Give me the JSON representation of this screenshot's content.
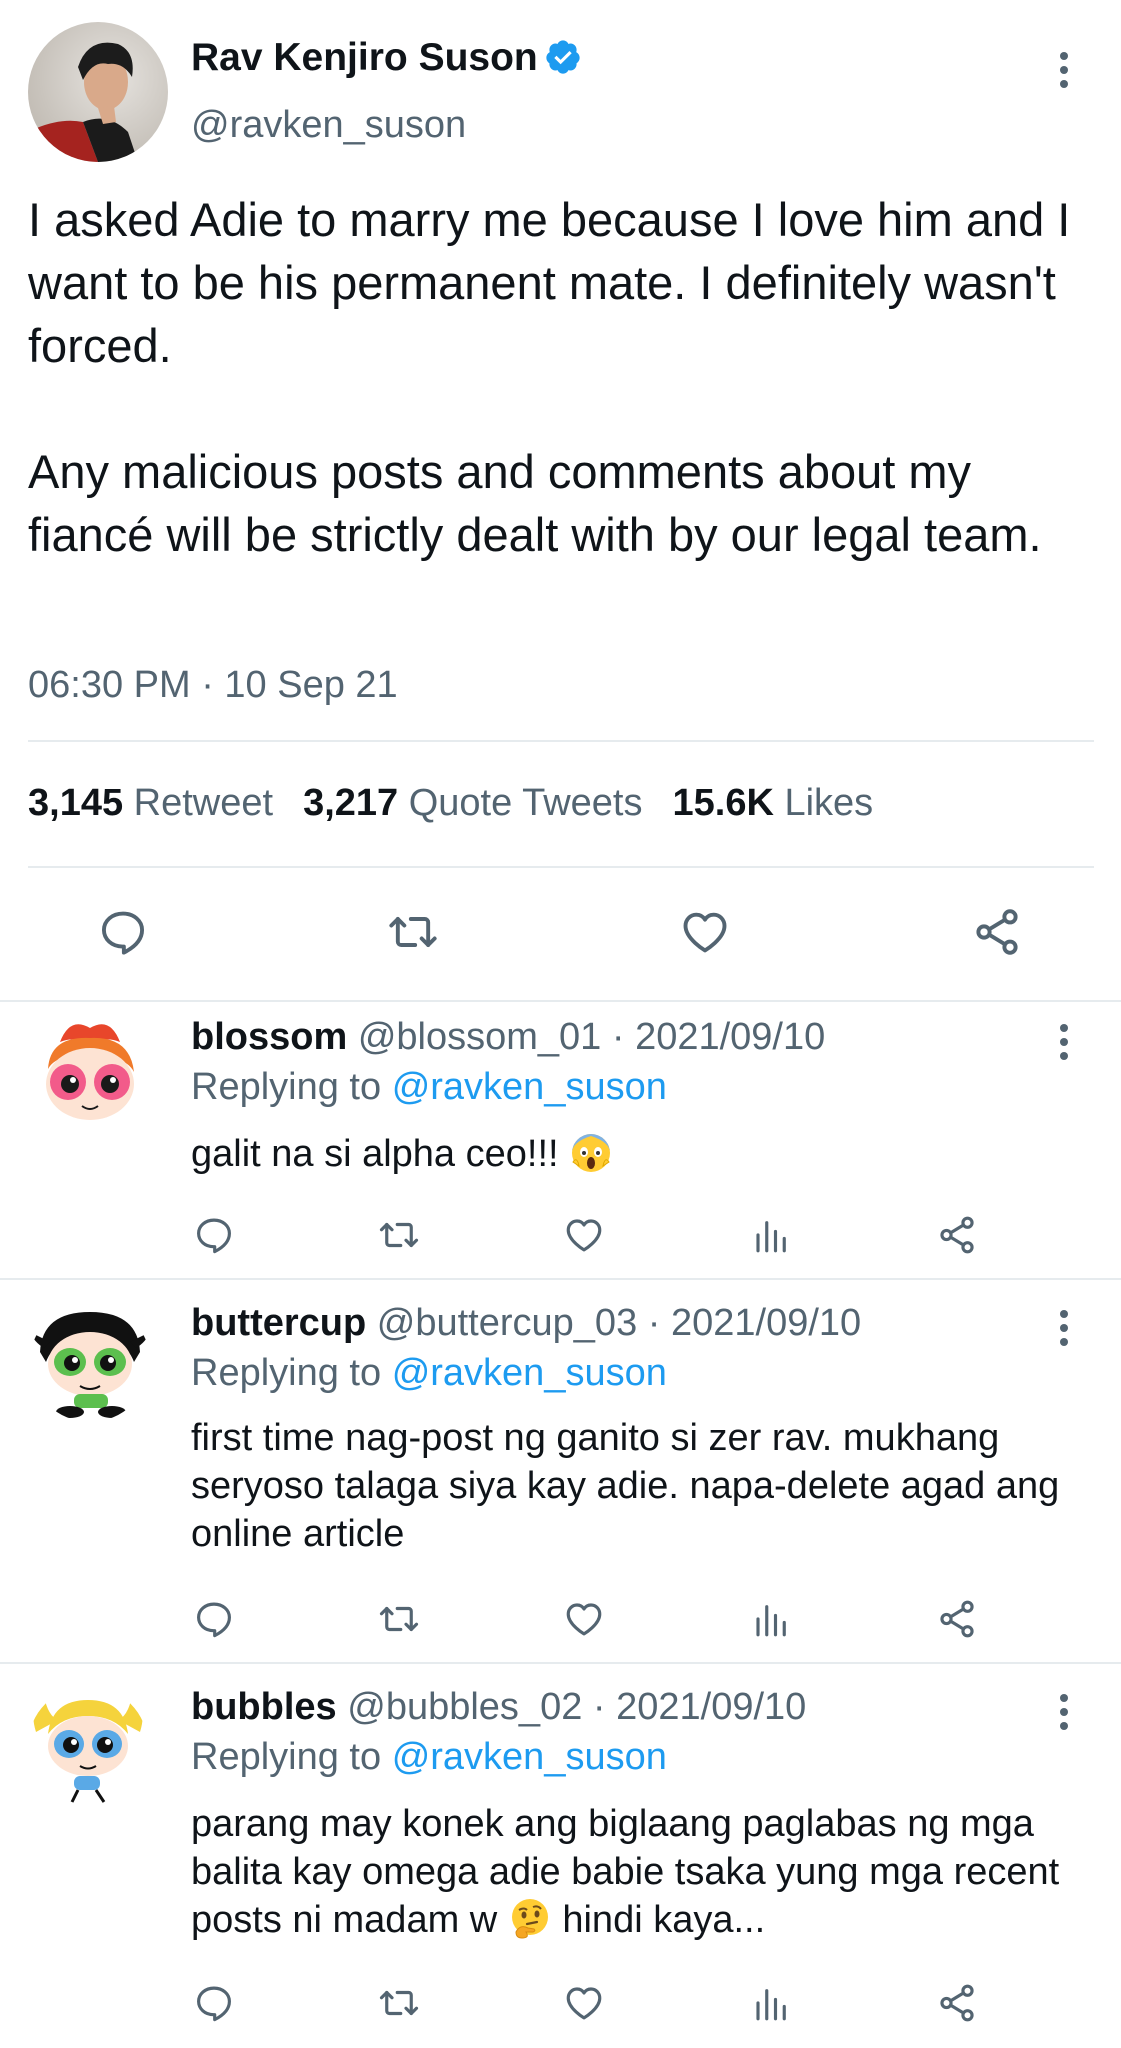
{
  "main_tweet": {
    "author_name": "Rav Kenjiro Suson",
    "author_handle": "@ravken_suson",
    "verified": true,
    "text_para_1": "I asked Adie to marry me because I love him and I want to be his permanent mate. I definitely wasn't forced.",
    "text_para_2": "Any malicious posts and comments about my fiancé will be strictly dealt with by our legal team.",
    "timestamp": "06:30 PM · 10 Sep 21",
    "stats": {
      "retweets": "3,145",
      "retweets_label": "Retweet",
      "quotes": "3,217",
      "quotes_label": "Quote Tweets",
      "likes": "15.6K",
      "likes_label": "Likes"
    },
    "actions": [
      "reply-icon",
      "retweet-icon",
      "like-icon",
      "share-icon"
    ]
  },
  "replies": [
    {
      "name": "blossom",
      "handle": "@blossom_01",
      "date": "· 2021/09/10",
      "replying_prefix": "Replying to",
      "replying_to": "@ravken_suson",
      "text": "galit na si alpha ceo!!!",
      "emoji": "face-screaming-in-fear",
      "avatar_color": "#f25b8a"
    },
    {
      "name": "buttercup",
      "handle": "@buttercup_03",
      "date": "· 2021/09/10",
      "replying_prefix": "Replying to",
      "replying_to": "@ravken_suson",
      "text": "first time nag-post ng ganito si zer rav. mukhang seryoso talaga siya kay adie. napa-delete agad ang online article",
      "avatar_color": "#5cbf4e"
    },
    {
      "name": "bubbles",
      "handle": "@bubbles_02",
      "date": "· 2021/09/10",
      "replying_prefix": "Replying to",
      "replying_to": "@ravken_suson",
      "text_before_emoji": "parang may konek ang biglaang paglabas ng mga balita kay omega adie babie tsaka yung mga recent posts ni madam w",
      "text_after_emoji": "hindi kaya...",
      "emoji": "thinking-face",
      "avatar_color": "#5aa9e6"
    }
  ],
  "colors": {
    "accent": "#1d9bf0",
    "muted": "#536471",
    "divider": "#e6ebee",
    "text": "#0f1419"
  }
}
